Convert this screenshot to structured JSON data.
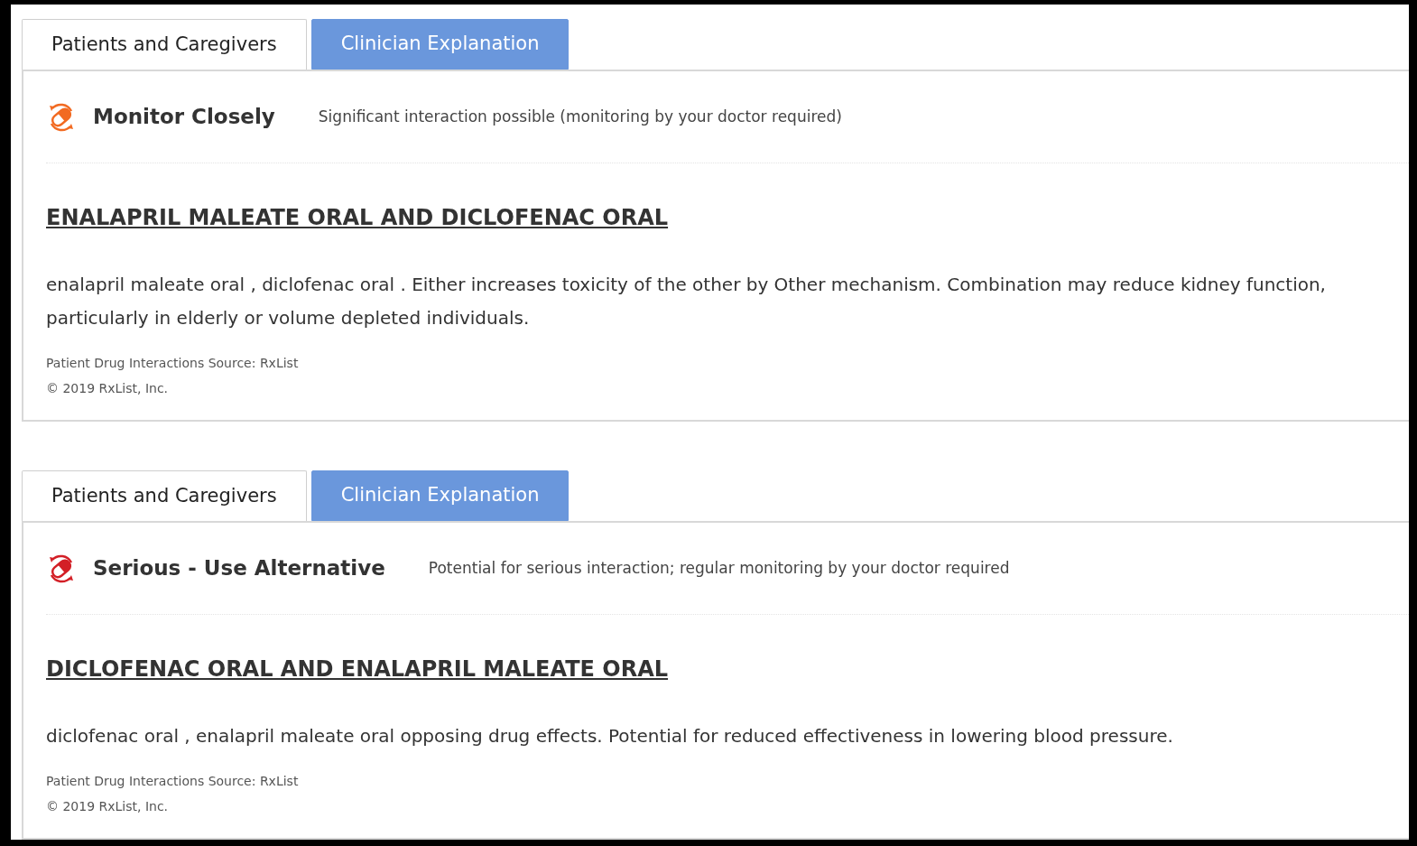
{
  "interactions": [
    {
      "tabs": [
        {
          "label": "Patients and Caregivers",
          "selected": false
        },
        {
          "label": "Clinician Explanation",
          "selected": true
        }
      ],
      "severity": {
        "kind": "monitor",
        "label": "Monitor Closely",
        "description": "Significant interaction possible (monitoring by your doctor required)"
      },
      "title": "ENALAPRIL MALEATE ORAL AND DICLOFENAC ORAL",
      "body": "enalapril maleate oral , diclofenac oral . Either increases toxicity of the other by Other mechanism. Combination may reduce kidney function, particularly in elderly or volume depleted individuals.",
      "source": "Patient Drug Interactions Source: RxList",
      "copyright": "© 2019 RxList, Inc."
    },
    {
      "tabs": [
        {
          "label": "Patients and Caregivers",
          "selected": false
        },
        {
          "label": "Clinician Explanation",
          "selected": true
        }
      ],
      "severity": {
        "kind": "serious",
        "label": "Serious - Use Alternative",
        "description": "Potential for serious interaction; regular monitoring by your doctor required"
      },
      "title": "DICLOFENAC ORAL AND ENALAPRIL MALEATE ORAL",
      "body": "diclofenac oral , enalapril maleate oral opposing drug effects. Potential for reduced effectiveness in lowering blood pressure.",
      "source": "Patient Drug Interactions Source: RxList",
      "copyright": "© 2019 RxList, Inc."
    }
  ]
}
